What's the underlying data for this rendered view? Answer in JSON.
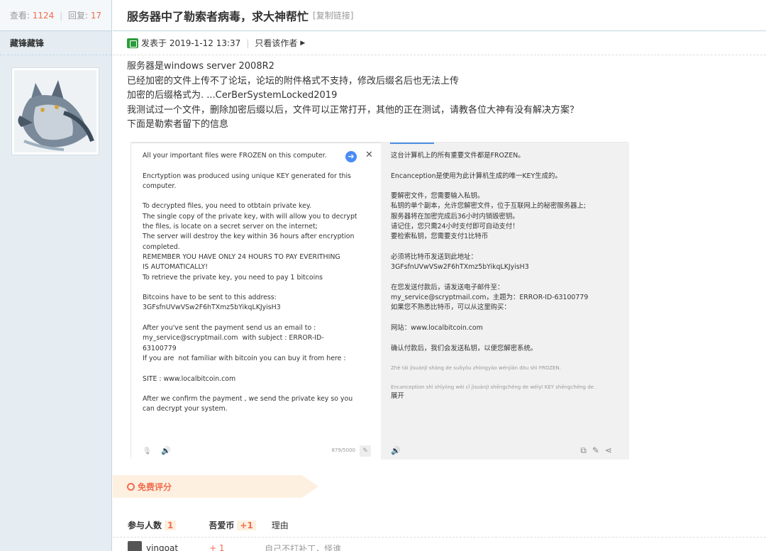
{
  "sidebar": {
    "views_label": "查看:",
    "views": "1124",
    "replies_label": "回复:",
    "replies": "17",
    "author": "藏锋藏锋"
  },
  "thread": {
    "title": "服务器中了勒索者病毒，求大神帮忙",
    "copy_link": "[复制链接]",
    "posted_at": "发表于 2019-1-12 13:37",
    "only_author": "只看该作者"
  },
  "body": {
    "lines": [
      "服务器是windows server 2008R2",
      "已经加密的文件上传不了论坛，论坛的附件格式不支持，修改后缀名后也无法上传",
      "加密的后缀格式为. ...CerBerSystemLocked2019",
      "我测试过一个文件，删除加密后缀以后，文件可以正常打开，其他的正在测试，请教各位大神有没有解决方案？",
      "下面是勒索者留下的信息"
    ]
  },
  "screenshot": {
    "left_lines": [
      "All your important files were FROZEN on this computer.",
      "",
      "Encrtyption was produced using unique KEY generated for this",
      "computer.",
      "",
      "To decrypted files, you need to otbtain private key.",
      "The single copy of the private key, with will allow you to decrypt",
      "the files, is locate on a secret server on the internet;",
      "The server will destroy the key within 36 hours after encryption",
      "completed.",
      "REMEMBER YOU HAVE ONLY 24 HOURS TO PAY EVERITHING",
      "IS AUTOMATICALLY!",
      "To retrieve the private key, you need to pay 1 bitcoins",
      "",
      "Bitcoins have to be sent to this address:",
      "3GFsfnUVwVSw2F6hTXmz5bYikqLKJyisH3",
      "",
      "After you've sent the payment send us an email to :",
      "my_service@scryptmail.com  with subject : ERROR-ID-",
      "63100779",
      "If you are  not familiar with bitcoin you can buy it from here :",
      "",
      "SITE : www.localbitcoin.com",
      "",
      "After we confirm the payment , we send the private key so you",
      "can decrypt your system."
    ],
    "right_lines": [
      "这台计算机上的所有重要文件都是FROZEN。",
      "",
      "Encanception是使用为此计算机生成的唯一KEY生成的。",
      "",
      "要解密文件，您需要输入私钥。",
      "私钥的单个副本，允许您解密文件，位于互联网上的秘密服务器上;",
      "服务器将在加密完成后36小时内销毁密钥。",
      "请记住，您只需24小时支付即可自动支付！",
      "要检索私钥，您需要支付1比特币",
      "",
      "必须将比特币发送到此地址：",
      "3GFsfnUVwVSw2F6hTXmz5bYikqLKJyisH3",
      "",
      "在您发送付款后，请发送电子邮件至：",
      "my_service@scryptmail.com，主题为：ERROR-ID-63100779",
      "如果您不熟悉比特币，可以从这里购买：",
      "",
      "网站：www.localbitcoin.com",
      "",
      "确认付款后，我们会发送私钥，以便您解密系统。"
    ],
    "pinyin_1": "Zhè tái jìsuànjī shàng de suǒyǒu zhòngyào wénjiàn dōu shì FROZEN.",
    "pinyin_2": "Encanception shì shǐyòng wèi cǐ jìsuànjī shēngchéng de wéiyī KEY shēngchéng de.",
    "expand": "展开",
    "char_count": "879/5000",
    "arrow": "➔",
    "close": "✕"
  },
  "rating": {
    "tag_label": "免费评分",
    "participants_label": "参与人数",
    "participants": "1",
    "coin_label": "吾爱币",
    "coin": "+1",
    "reason_label": "理由",
    "row_user": "yingoat",
    "row_score": "+ 1",
    "row_reason": "自己不打补丁，怪谁"
  }
}
